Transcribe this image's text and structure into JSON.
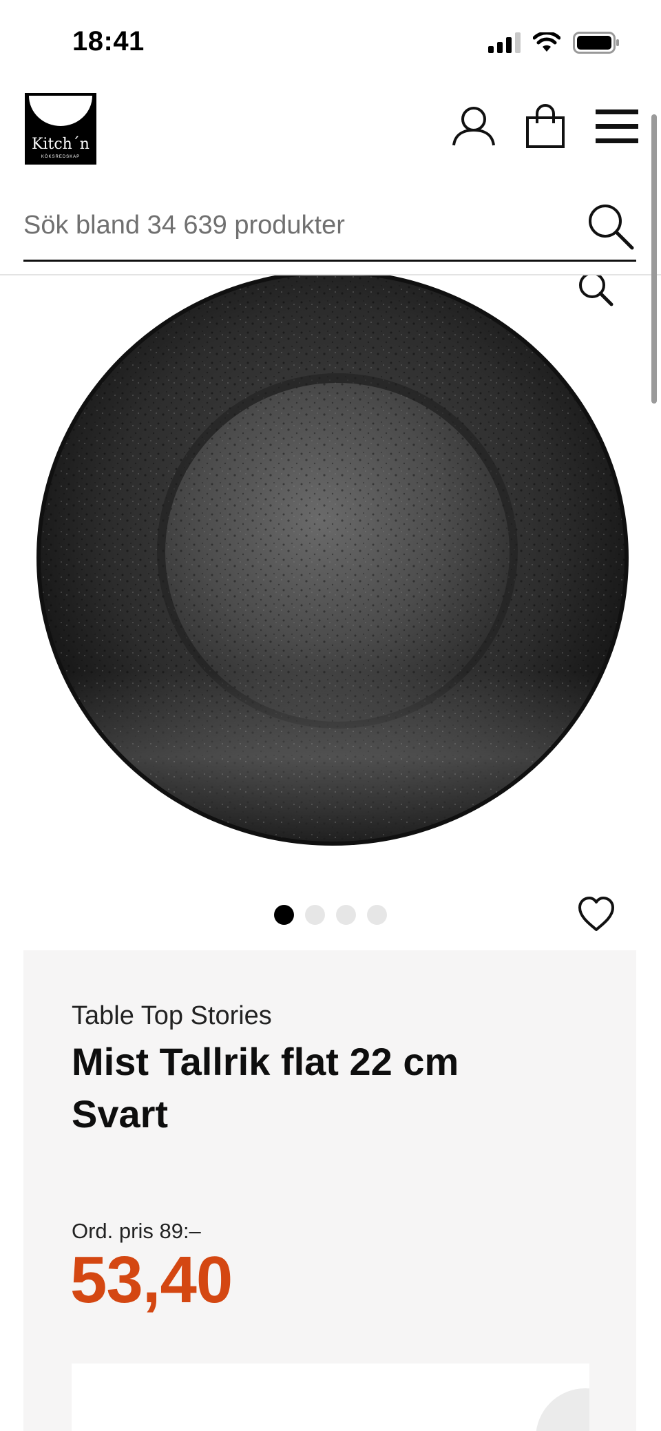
{
  "status_bar": {
    "time": "18:41"
  },
  "header": {
    "logo_text": "Kitch´n",
    "logo_subtext": "KÖKSREDSKAP",
    "search_placeholder": "Sök bland 34 639 produkter",
    "icons": [
      "account-icon",
      "cart-icon",
      "menu-icon",
      "search-icon"
    ]
  },
  "gallery": {
    "dot_count": 4,
    "active_index": 0
  },
  "product": {
    "brand": "Table Top Stories",
    "title": "Mist Tallrik flat 22 cm Svart",
    "ord_price": "Ord. pris 89:–",
    "price": "53,40"
  },
  "colors": {
    "price": "#d44712",
    "panel_bg": "#f6f5f5"
  }
}
